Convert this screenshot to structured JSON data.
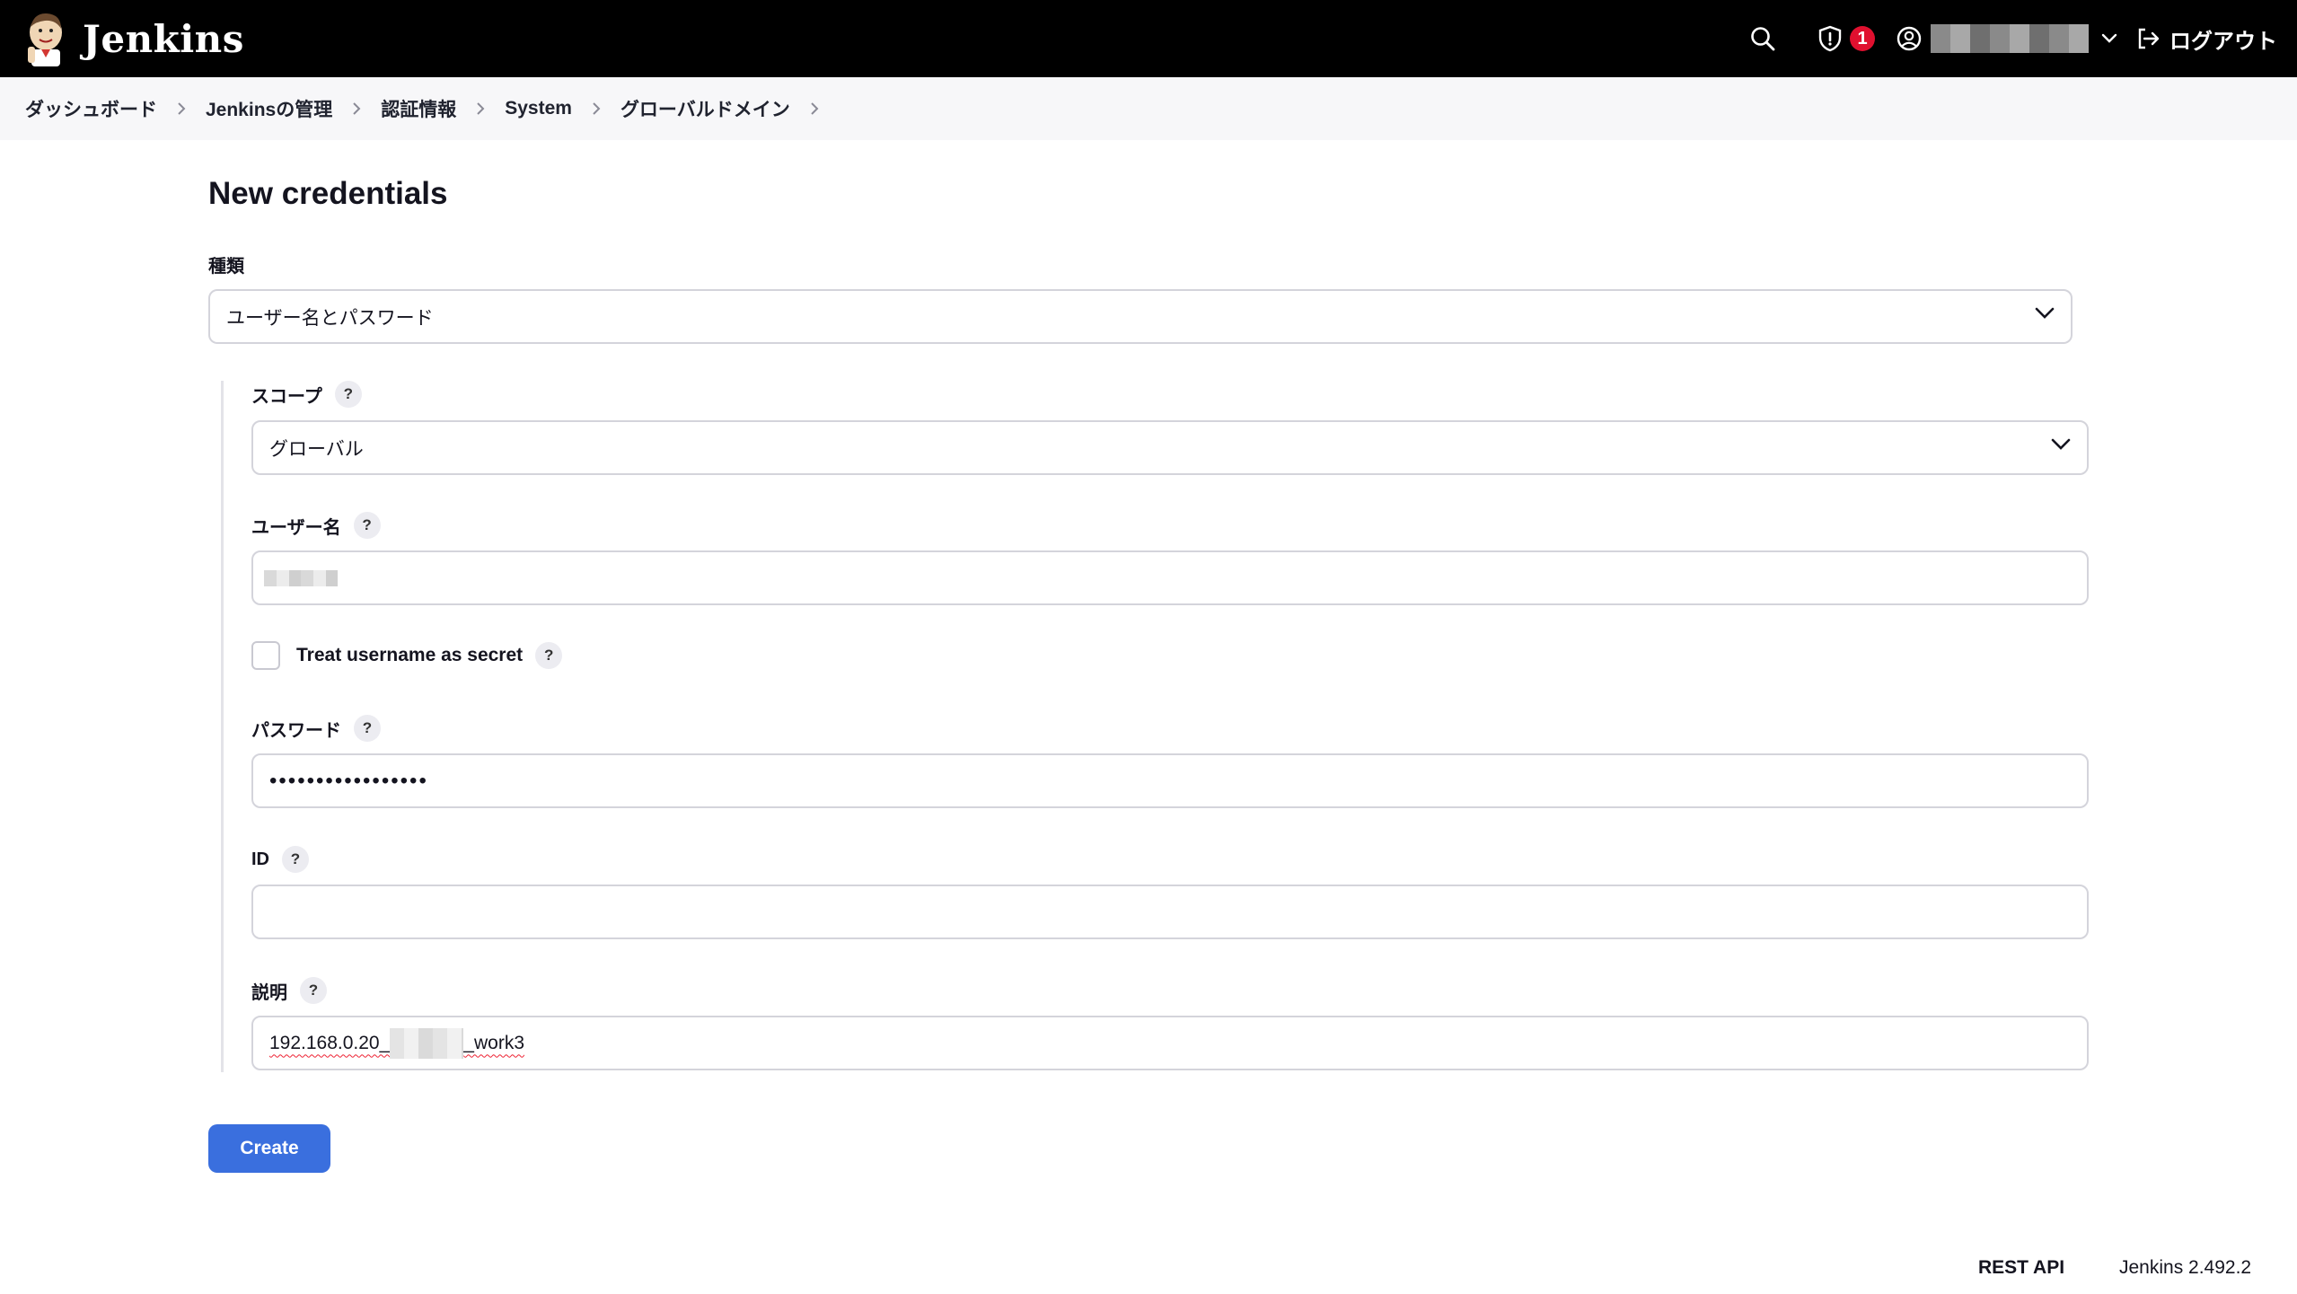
{
  "header": {
    "brand": "Jenkins",
    "security_badge_count": "1",
    "logout_label": "ログアウト"
  },
  "breadcrumb": [
    "ダッシュボード",
    "Jenkinsの管理",
    "認証情報",
    "System",
    "グローバルドメイン"
  ],
  "page": {
    "title": "New credentials"
  },
  "form": {
    "kind_label": "種類",
    "kind_value": "ユーザー名とパスワード",
    "scope_label": "スコープ",
    "scope_value": "グローバル",
    "username_label": "ユーザー名",
    "treat_secret_label": "Treat username as secret",
    "treat_secret_checked": false,
    "password_label": "パスワード",
    "password_value": "•••••••••••••••••",
    "id_label": "ID",
    "id_value": "",
    "description_label": "説明",
    "description_value_prefix": "192.168.0.20_",
    "description_value_suffix": "_work3",
    "help_mark": "?",
    "create_label": "Create"
  },
  "footer": {
    "rest_api": "REST API",
    "version": "Jenkins 2.492.2"
  },
  "colors": {
    "header_bg": "#000000",
    "badge": "#e0102f",
    "primary_button": "#3a6fde",
    "breadcrumb_bg": "#f7f7f9"
  },
  "icons": [
    "jenkins-logo",
    "search-icon",
    "shield-icon",
    "user-circle-icon",
    "chevron-down-icon",
    "logout-icon",
    "chevron-right-icon",
    "help-icon"
  ]
}
